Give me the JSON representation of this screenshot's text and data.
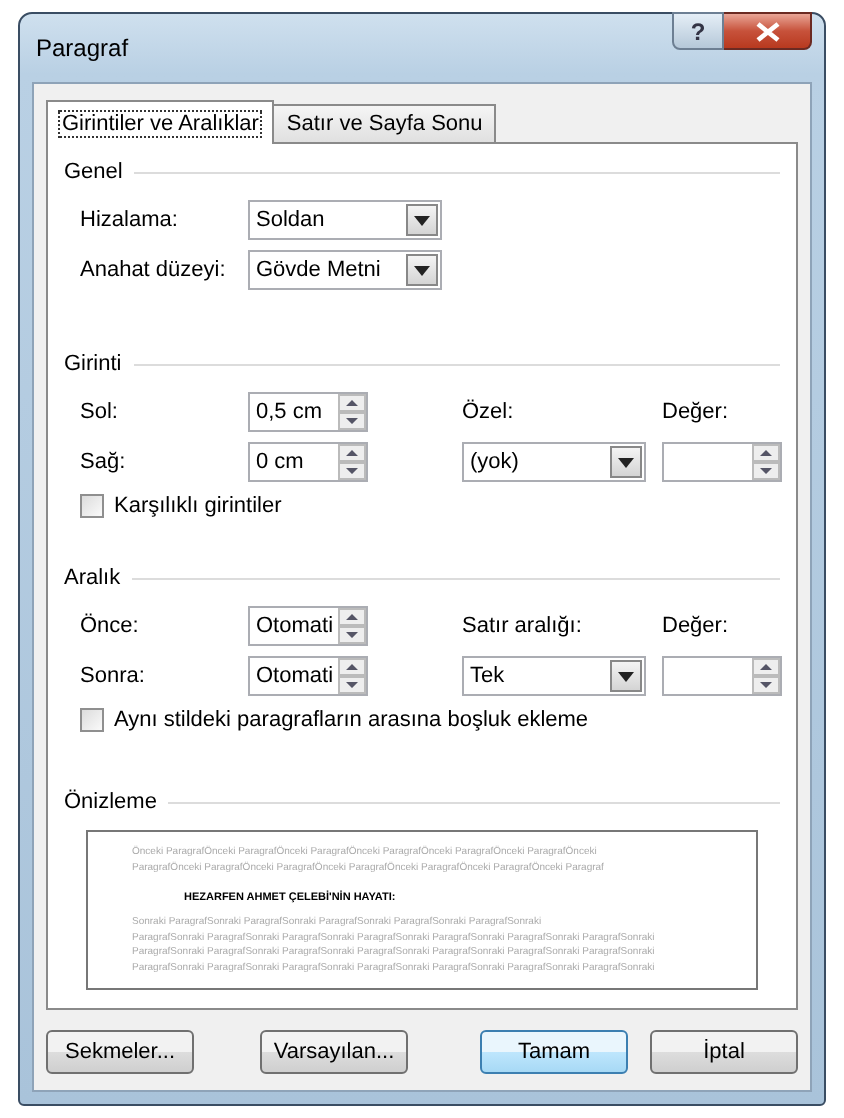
{
  "window": {
    "title": "Paragraf"
  },
  "help_button": {
    "label": "?"
  },
  "tabs": [
    {
      "label": "Girintiler ve Aralıklar",
      "selected": true
    },
    {
      "label": "Satır ve Sayfa Sonu",
      "selected": false
    }
  ],
  "general": {
    "title": "Genel",
    "rows": [
      {
        "label": "Hizalama:",
        "value": "Soldan"
      },
      {
        "label": "Anahat düzeyi:",
        "value": "Gövde Metni"
      }
    ]
  },
  "indentation": {
    "title": "Girinti",
    "left": {
      "label": "Sol:",
      "value": "0,5 cm"
    },
    "right": {
      "label": "Sağ:",
      "value": "0 cm"
    },
    "special": {
      "label": "Özel:",
      "value": "(yok)"
    },
    "by": {
      "label": "Değer:"
    },
    "mirror": {
      "label": "Karşılıklı girintiler",
      "checked": false
    }
  },
  "spacing": {
    "title": "Aralık",
    "before": {
      "label": "Önce:",
      "value": "Otomati"
    },
    "after": {
      "label": "Sonra:",
      "value": "Otomati"
    },
    "line_spacing": {
      "label": "Satır aralığı:",
      "value": "Tek"
    },
    "at": {
      "label": "Değer:"
    },
    "dont_add": {
      "label": "Aynı stildeki paragrafların arasına boşluk ekleme",
      "checked": false
    }
  },
  "preview": {
    "title": "Önizleme",
    "previous_lines": [
      "Önceki ParagrafÖnceki ParagrafÖnceki ParagrafÖnceki ParagrafÖnceki ParagrafÖnceki ParagrafÖnceki",
      "ParagrafÖnceki ParagrafÖnceki ParagrafÖnceki ParagrafÖnceki ParagrafÖnceki ParagrafÖnceki Paragraf"
    ],
    "sample": "HEZARFEN AHMET ÇELEBİ'NİN HAYATI:",
    "following_lines": [
      "Sonraki ParagrafSonraki ParagrafSonraki ParagrafSonraki ParagrafSonraki ParagrafSonraki",
      "ParagrafSonraki ParagrafSonraki ParagrafSonraki ParagrafSonraki ParagrafSonraki ParagrafSonraki ParagrafSonraki",
      "ParagrafSonraki ParagrafSonraki ParagrafSonraki ParagrafSonraki ParagrafSonraki ParagrafSonraki ParagrafSonraki",
      "ParagrafSonraki ParagrafSonraki ParagrafSonraki ParagrafSonraki ParagrafSonraki ParagrafSonraki ParagrafSonraki"
    ]
  },
  "buttons": [
    {
      "label": "Sekmeler...",
      "default": false
    },
    {
      "label": "Varsayılan...",
      "default": false
    },
    {
      "label": "Tamam",
      "default": true
    },
    {
      "label": "İptal",
      "default": false
    }
  ]
}
